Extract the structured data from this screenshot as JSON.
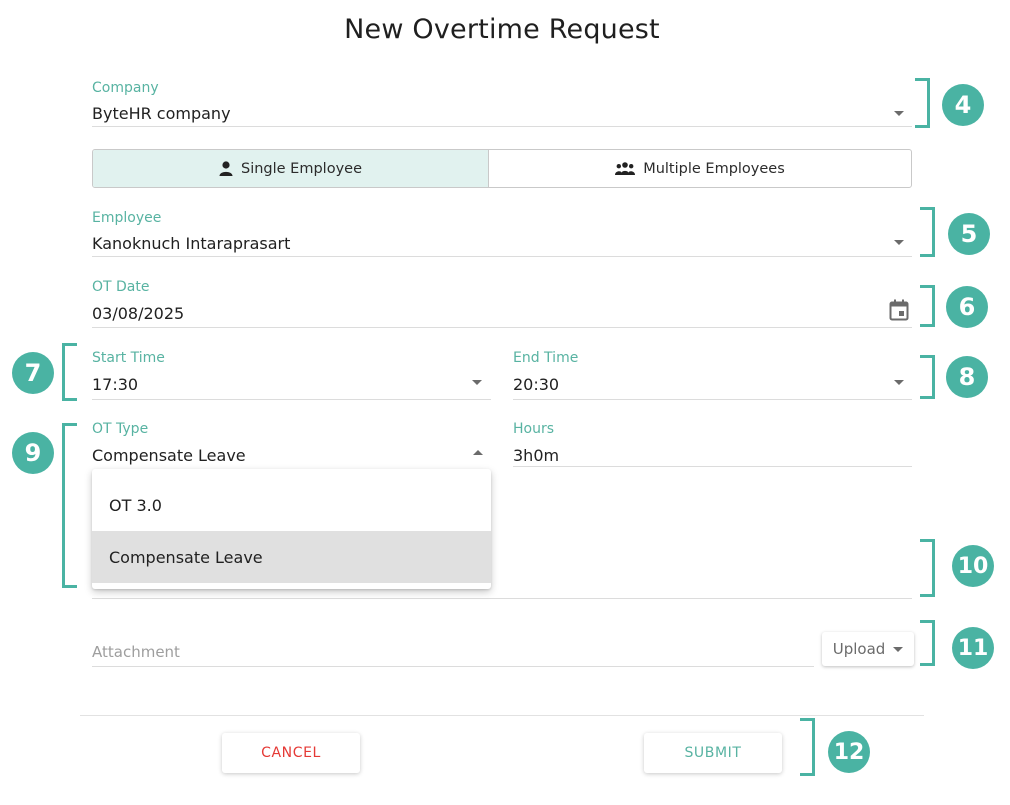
{
  "dialog": {
    "title": "New Overtime Request"
  },
  "company": {
    "label": "Company",
    "value": "ByteHR company"
  },
  "mode": {
    "single": "Single Employee",
    "multiple": "Multiple Employees",
    "selected": "single"
  },
  "employee": {
    "label": "Employee",
    "value": "Kanoknuch Intaraprasart"
  },
  "ot_date": {
    "label": "OT Date",
    "value": "03/08/2025"
  },
  "start_time": {
    "label": "Start Time",
    "value": "17:30"
  },
  "end_time": {
    "label": "End Time",
    "value": "20:30"
  },
  "ot_type": {
    "label": "OT Type",
    "value": "Compensate Leave",
    "options": [
      "OT 3.0",
      "Compensate Leave"
    ],
    "selected_index": 1
  },
  "hours": {
    "label": "Hours",
    "value": "3h0m"
  },
  "attachment": {
    "label": "Attachment",
    "upload_label": "Upload"
  },
  "actions": {
    "cancel": "CANCEL",
    "submit": "SUBMIT"
  },
  "callouts": [
    "4",
    "5",
    "6",
    "7",
    "8",
    "9",
    "10",
    "11",
    "12"
  ],
  "colors": {
    "accent": "#4ab3a3",
    "label": "#58b3a2",
    "cancel": "#e53935",
    "selected_bg": "#e1f2ef"
  },
  "icons": {
    "dropdown": "caret-down-icon",
    "calendar": "calendar-icon",
    "single": "person-icon",
    "multiple": "group-icon"
  }
}
